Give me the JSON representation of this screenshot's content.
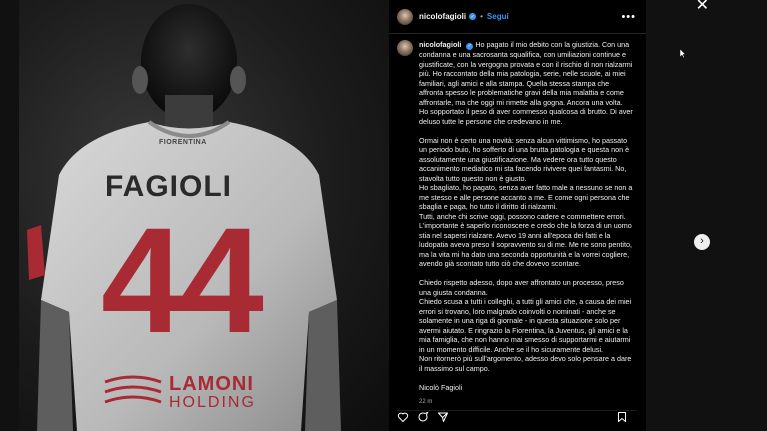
{
  "close_label": "✕",
  "post": {
    "username": "nicolofagioli",
    "follow_label": "Segui",
    "more_label": "•••",
    "jersey": {
      "sponsor_top": "FIORENTINA",
      "name": "FAGIOLI",
      "number": "44",
      "sponsor_line1": "LAMONI",
      "sponsor_line2": "HOLDING"
    },
    "caption_paragraphs": [
      "Ho pagato il mio debito con la giustizia. Con una condanna e una sacrosanta squalifica, con umiliazioni continue e giustificate, con la vergogna provata e con il rischio di non rialzarmi più. Ho raccontato della mia patologia, serie, nelle scuole, ai miei familiari, agli amici e alla stampa. Quella stessa stampa che affronta spesso le problematiche gravi della mia malattia e come affrontarle, ma che oggi mi rimette alla gogna. Ancora una volta.\nHo sopportato il peso di aver commesso qualcosa di brutto. Di aver deluso tutte le persone che credevano in me.",
      "Ormai non è certo una novità: senza alcun vittimismo, ho passato un periodo buio, ho sofferto di una brutta patologia e questa non è assolutamente una giustificazione. Ma vedere ora tutto questo accanimento mediatico mi sta facendo rivivere quei fantasmi. No, stavolta tutto questo non è giusto.\nHo sbagliato, ho pagato, senza aver fatto male a nessuno se non a me stesso e alle persone accanto a me. E come ogni persona che sbaglia e paga, ho tutto il diritto di rialzarmi.\nTutti, anche chi scrive oggi, possono cadere e commettere errori. L'importante è saperlo riconoscere e credo che la forza di un uomo stia nel sapersi rialzare. Avevo 19 anni all'epoca dei fatti e la ludopatia aveva preso il sopravvento su di me. Me ne sono pentito, ma la vita mi ha dato una seconda opportunità e la vorrei cogliere, avendo già scontato tutto ciò che dovevo scontare.",
      "Chiedo rispetto adesso, dopo aver affrontato un processo, preso una giusta condanna.\nChiedo scusa a tutti i colleghi, a tutti gli amici che, a causa dei miei errori si trovano, loro malgrado coinvolti o nominati - anche se solamente in una riga di giornale - in questa situazione solo per avermi aiutato. E ringrazio la Fiorentina, la Juventus, gli amici e la mia famiglia, che non hanno mai smesso di supportarmi e aiutarmi in un momento difficile. Anche se il ho sicuramente delusi.\nNon ritornerò più sull'argomento, adesso devo solo pensare a dare il massimo sul campo.",
      "Nicolò Fagioli"
    ],
    "time": "22 m"
  },
  "next_label": "›"
}
